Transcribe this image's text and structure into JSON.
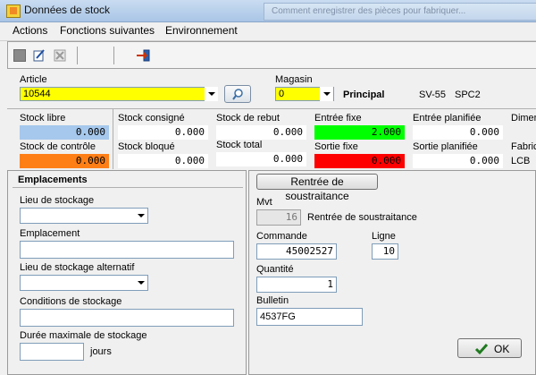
{
  "window": {
    "title": "Données de stock",
    "background_title": "Comment enregistrer des pièces pour fabriquer..."
  },
  "menu": {
    "items": [
      "Actions",
      "Fonctions suivantes",
      "Environnement"
    ]
  },
  "header": {
    "article_label": "Article",
    "article_value": "10544",
    "magasin_label": "Magasin",
    "magasin_value": "0",
    "principal_label": "Principal",
    "code1": "SV-55",
    "code2": "SPC2"
  },
  "stock": {
    "libre_label": "Stock libre",
    "libre_value": "0.000",
    "consigne_label": "Stock consigné",
    "consigne_value": "0.000",
    "rebut_label": "Stock de rebut",
    "rebut_value": "0.000",
    "entree_fixe_label": "Entrée fixe",
    "entree_fixe_value": "2.000",
    "entree_planifiee_label": "Entrée planifiée",
    "entree_planifiee_value": "0.000",
    "dimen_label": "Dimen",
    "controle_label": "Stock de contrôle",
    "controle_value": "0.000",
    "bloque_label": "Stock bloqué",
    "bloque_value": "0.000",
    "total_label": "Stock total",
    "total_value": "0.000",
    "sortie_fixe_label": "Sortie fixe",
    "sortie_fixe_value": "0.000",
    "sortie_planifiee_label": "Sortie planifiée",
    "sortie_planifiee_value": "0.000",
    "fabric_label": "Fabric",
    "fabric_value": "LCB"
  },
  "emplacements": {
    "title": "Emplacements",
    "lieu_label": "Lieu de stockage",
    "lieu_value": "",
    "emplacement_label": "Emplacement",
    "emplacement_value": "",
    "lieu_alt_label": "Lieu de stockage alternatif",
    "lieu_alt_value": "",
    "conditions_label": "Conditions de stockage",
    "conditions_value": "",
    "duree_label": "Durée maximale de stockage",
    "duree_value": "",
    "jours_label": "jours"
  },
  "soustraitance": {
    "button_label": "Rentrée de soustraitance",
    "mvt_label": "Mvt",
    "mvt_value": "16",
    "mvt_text": "Rentrée de soustraitance",
    "commande_label": "Commande",
    "commande_value": "45002527",
    "ligne_label": "Ligne",
    "ligne_value": "10",
    "quantite_label": "Quantité",
    "quantite_value": "1",
    "bulletin_label": "Bulletin",
    "bulletin_value": "4537FG",
    "ok_label": "OK"
  },
  "colors": {
    "libre_bg": "#a6c8ec",
    "controle_bg": "#ff7f17",
    "entree_fixe_bg": "#00ff00",
    "sortie_fixe_bg": "#ff0000",
    "highlight": "#ffff00"
  }
}
